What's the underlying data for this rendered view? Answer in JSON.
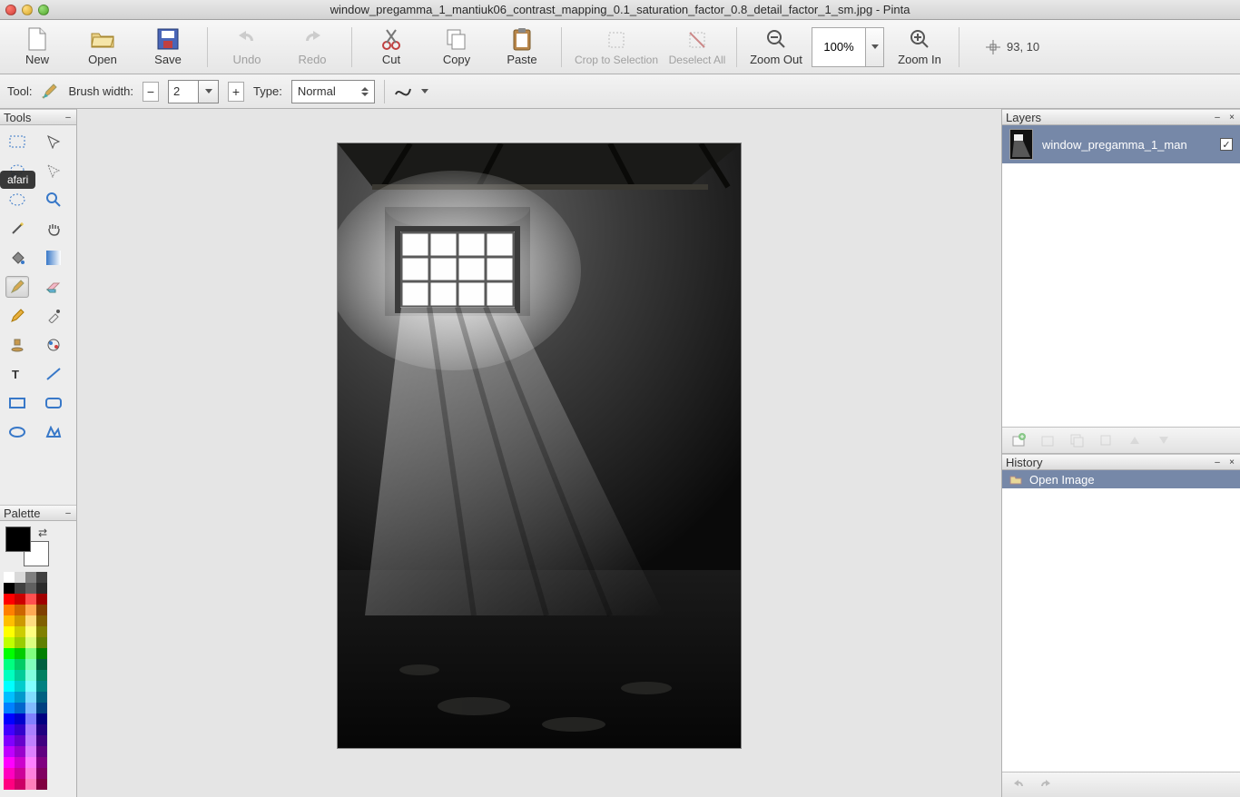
{
  "window": {
    "title": "window_pregamma_1_mantiuk06_contrast_mapping_0.1_saturation_factor_0.8_detail_factor_1_sm.jpg - Pinta"
  },
  "toolbar": {
    "new": "New",
    "open": "Open",
    "save": "Save",
    "undo": "Undo",
    "redo": "Redo",
    "cut": "Cut",
    "copy": "Copy",
    "paste": "Paste",
    "crop": "Crop to Selection",
    "deselect": "Deselect All",
    "zoom_out": "Zoom Out",
    "zoom_val": "100%",
    "zoom_in": "Zoom In",
    "coords": "93, 10"
  },
  "options": {
    "tool_label": "Tool:",
    "brush_label": "Brush width:",
    "brush_value": "2",
    "type_label": "Type:",
    "type_value": "Normal"
  },
  "panels": {
    "tools": "Tools",
    "palette": "Palette",
    "layers": "Layers",
    "history": "History"
  },
  "tooltip": {
    "safari": "afari"
  },
  "layers": {
    "items": [
      {
        "name": "window_pregamma_1_man",
        "visible": true
      }
    ]
  },
  "history": {
    "items": [
      {
        "label": "Open Image"
      }
    ]
  },
  "palette": {
    "fg": "#000000",
    "bg": "#ffffff",
    "colors": [
      "#ffffff",
      "#d9d9d9",
      "#808080",
      "#404040",
      "#000000",
      "#404040",
      "#606060",
      "#2b2b2b",
      "#ff0000",
      "#cc0000",
      "#ff5050",
      "#a00000",
      "#ff8000",
      "#cc6600",
      "#ffaa55",
      "#804000",
      "#ffbf00",
      "#cc9900",
      "#ffdd80",
      "#806000",
      "#ffff00",
      "#cccc00",
      "#ffff80",
      "#808000",
      "#bfff00",
      "#99cc00",
      "#ddff80",
      "#608000",
      "#00ff00",
      "#00cc00",
      "#80ff80",
      "#008000",
      "#00ff80",
      "#00cc66",
      "#80ffbb",
      "#006040",
      "#00ffbf",
      "#00cc99",
      "#80ffdd",
      "#008060",
      "#00ffff",
      "#00cccc",
      "#80ffff",
      "#008080",
      "#00bfff",
      "#0099cc",
      "#80ddff",
      "#006080",
      "#0080ff",
      "#0066cc",
      "#80bbff",
      "#004080",
      "#0000ff",
      "#0000cc",
      "#8080ff",
      "#000080",
      "#4000ff",
      "#3300cc",
      "#aa80ff",
      "#200080",
      "#8000ff",
      "#6600cc",
      "#bf80ff",
      "#400080",
      "#bf00ff",
      "#9900cc",
      "#dd80ff",
      "#600080",
      "#ff00ff",
      "#cc00cc",
      "#ff80ff",
      "#800080",
      "#ff00bf",
      "#cc0099",
      "#ff80dd",
      "#800060",
      "#ff0080",
      "#cc0066",
      "#ff80bb",
      "#800040"
    ]
  }
}
